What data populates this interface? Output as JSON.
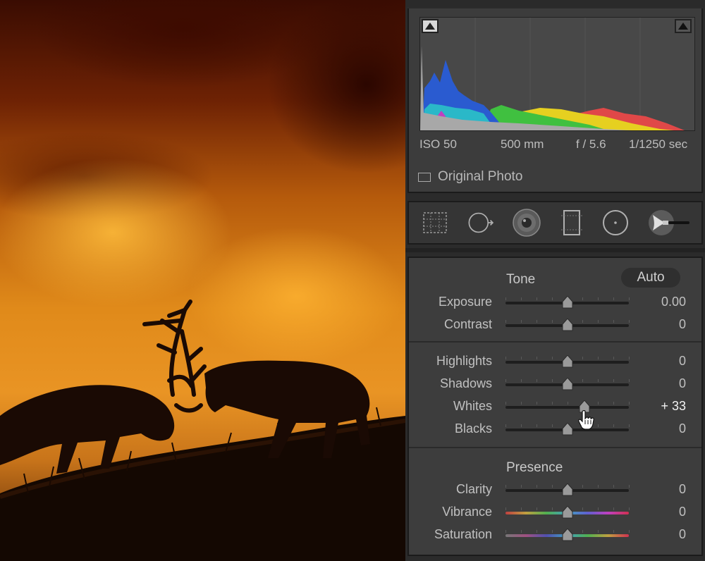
{
  "histogram": {
    "iso": "ISO 50",
    "focal_length": "500 mm",
    "aperture": "f / 5.6",
    "shutter": "1/1250 sec",
    "original_photo_label": "Original Photo",
    "original_photo_checked": false
  },
  "tools": [
    {
      "name": "crop-overlay-icon"
    },
    {
      "name": "spot-removal-icon"
    },
    {
      "name": "red-eye-icon"
    },
    {
      "name": "graduated-filter-icon"
    },
    {
      "name": "radial-filter-icon"
    },
    {
      "name": "adjustment-brush-icon"
    }
  ],
  "tone": {
    "title": "Tone",
    "auto_label": "Auto",
    "sliders": [
      {
        "label": "Exposure",
        "value": "0.00",
        "position": 0.5
      },
      {
        "label": "Contrast",
        "value": "0",
        "position": 0.5
      }
    ],
    "sliders2": [
      {
        "label": "Highlights",
        "value": "0",
        "position": 0.5
      },
      {
        "label": "Shadows",
        "value": "0",
        "position": 0.5
      },
      {
        "label": "Whites",
        "value": "+ 33",
        "position": 0.64,
        "active": true
      },
      {
        "label": "Blacks",
        "value": "0",
        "position": 0.5
      }
    ]
  },
  "presence": {
    "title": "Presence",
    "sliders": [
      {
        "label": "Clarity",
        "value": "0",
        "position": 0.5
      },
      {
        "label": "Vibrance",
        "value": "0",
        "position": 0.5
      },
      {
        "label": "Saturation",
        "value": "0",
        "position": 0.5
      }
    ]
  },
  "colors": {
    "panel_bg": "#3d3d3d",
    "text": "#c0c0c0",
    "histogram_blue": "#2a5bd0",
    "histogram_yellow": "#e6d020",
    "histogram_red": "#e04848",
    "histogram_green": "#40c040"
  }
}
